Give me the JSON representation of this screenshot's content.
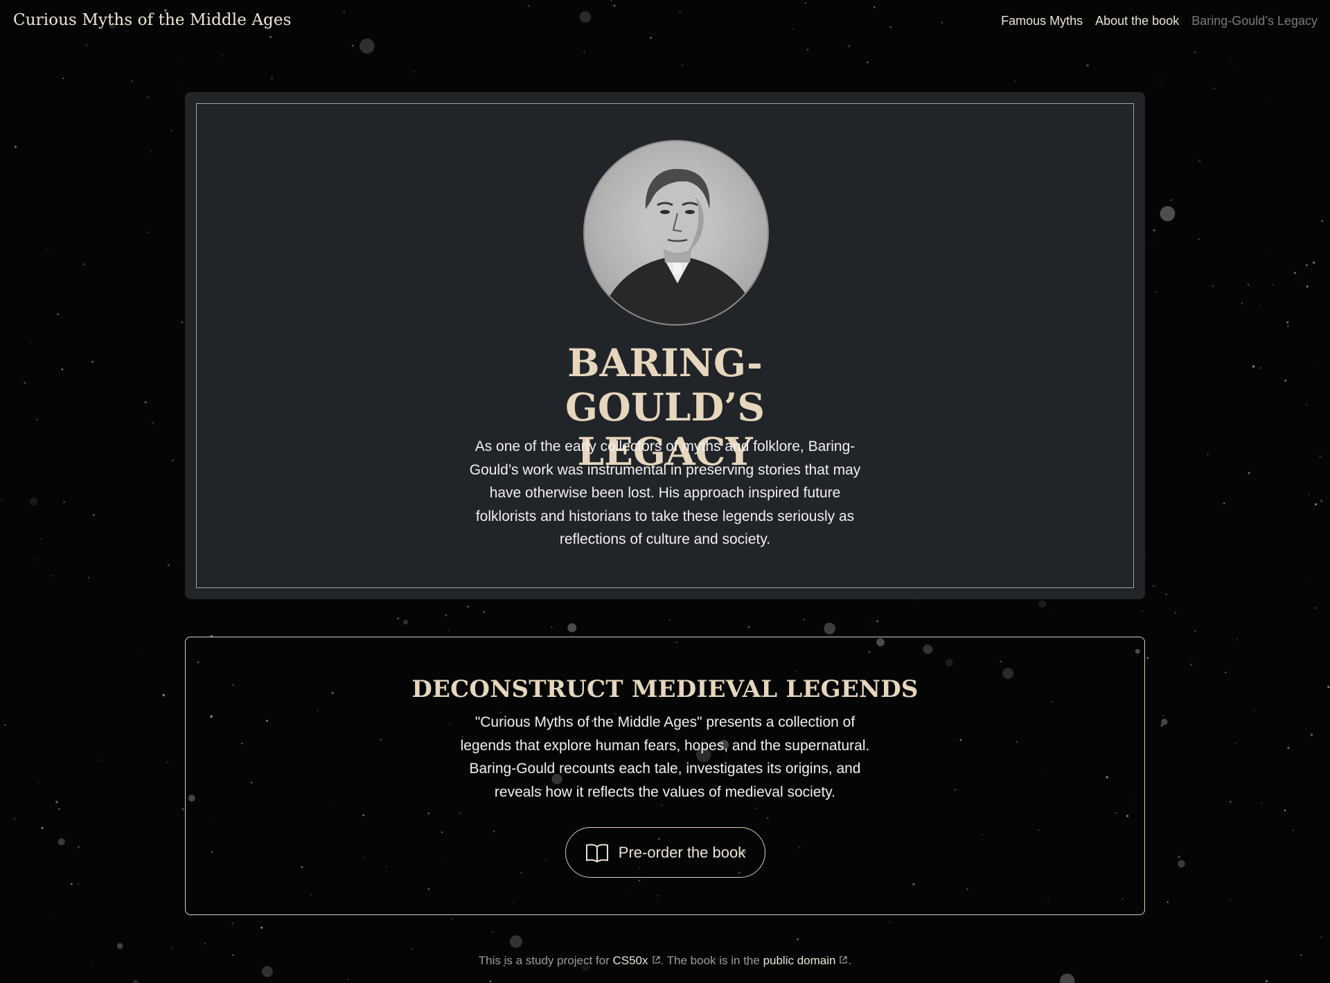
{
  "header": {
    "site_title": "Curious Myths of the Middle Ages",
    "nav": [
      {
        "label": "Famous Myths",
        "active": false
      },
      {
        "label": "About the book",
        "active": false
      },
      {
        "label": "Baring-Gould’s Legacy",
        "active": true
      }
    ]
  },
  "legacy": {
    "portrait_alt": "portrait",
    "title": "BARING-GOULD’S LEGACY",
    "text": "As one of the early collectors of myths and folklore, Baring-Gould’s work was instrumental in preserving stories that may have otherwise been lost. His approach inspired future folklorists and historians to take these legends seriously as reflections of culture and society."
  },
  "legends": {
    "title": "DECONSTRUCT MEDIEVAL LEGENDS",
    "text": "\"Curious Myths of the Middle Ages\" presents a collection of legends that explore human fears, hopes, and the supernatural. Baring-Gould recounts each tale, investigates its origins, and reveals how it reflects the values of medieval society.",
    "button_label": "Pre-order the book",
    "button_icon": "book-icon"
  },
  "footer": {
    "text_before": "This is a study project for ",
    "link1": "CS50x",
    "text_middle": ". The book is in the ",
    "link2": "public domain",
    "text_after": "."
  },
  "colors": {
    "background": "#050505",
    "card": "#212428",
    "accent_gold": "#e6d6bd",
    "muted": "#9c9ba0"
  }
}
